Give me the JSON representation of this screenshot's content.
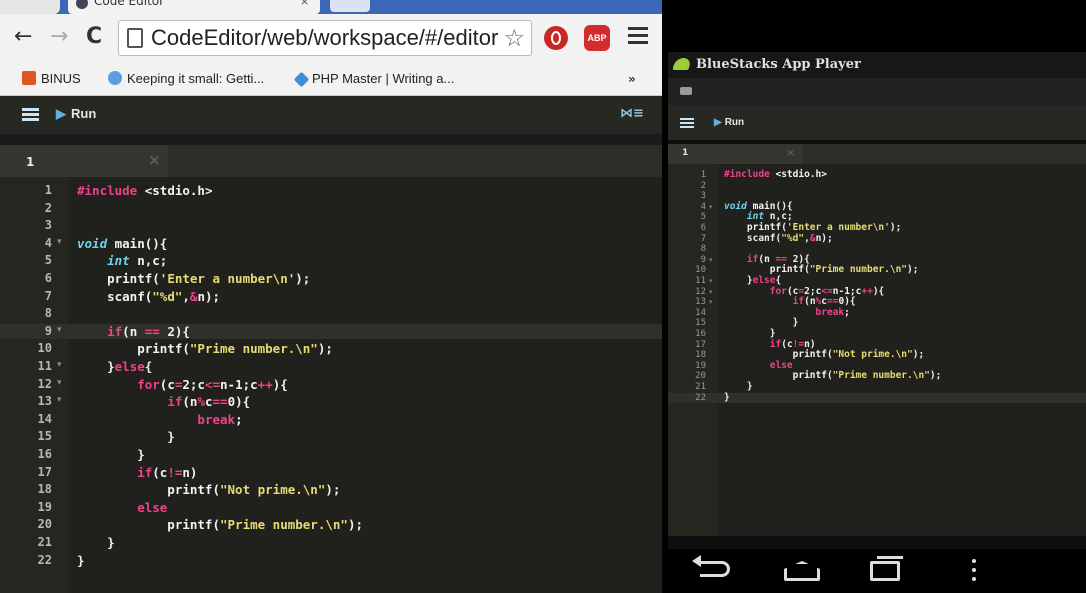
{
  "browser": {
    "tab_title": "Code Editor",
    "tab_close": "×",
    "url": "CodeEditor/web/workspace/#/editor",
    "bookmarks": [
      {
        "label": "BINUS"
      },
      {
        "label": "Keeping it small: Getti..."
      },
      {
        "label": "PHP Master | Writing a..."
      }
    ],
    "bookmarks_more": "»",
    "extensions": {
      "abp_label": "ABP"
    }
  },
  "editor": {
    "run_label": "Run",
    "file_tab": "1",
    "file_tab_close": "×",
    "lines": [
      {
        "n": "1",
        "text": "#include <stdio.h>"
      },
      {
        "n": "2",
        "text": ""
      },
      {
        "n": "3",
        "text": ""
      },
      {
        "n": "4",
        "text": "void main(){"
      },
      {
        "n": "5",
        "text": "    int n,c;"
      },
      {
        "n": "6",
        "text": "    printf('Enter a number\\n');"
      },
      {
        "n": "7",
        "text": "    scanf(\"%d\",&n);"
      },
      {
        "n": "8",
        "text": ""
      },
      {
        "n": "9",
        "text": "    if(n == 2){"
      },
      {
        "n": "10",
        "text": "        printf(\"Prime number.\\n\");"
      },
      {
        "n": "11",
        "text": "    }else{"
      },
      {
        "n": "12",
        "text": "        for(c=2;c<=n-1;c++){"
      },
      {
        "n": "13",
        "text": "            if(n%c==0){"
      },
      {
        "n": "14",
        "text": "                break;"
      },
      {
        "n": "15",
        "text": "            }"
      },
      {
        "n": "16",
        "text": "        }"
      },
      {
        "n": "17",
        "text": "        if(c!=n)"
      },
      {
        "n": "18",
        "text": "            printf(\"Not prime.\\n\");"
      },
      {
        "n": "19",
        "text": "        else"
      },
      {
        "n": "20",
        "text": "            printf(\"Prime number.\\n\");"
      },
      {
        "n": "21",
        "text": "    }"
      },
      {
        "n": "22",
        "text": "}"
      }
    ]
  },
  "bluestacks": {
    "title": "BlueStacks App Player",
    "run_label": "Run",
    "file_tab": "1",
    "file_tab_close": "×",
    "lines": [
      {
        "n": "1",
        "text": "#include <stdio.h>"
      },
      {
        "n": "2",
        "text": ""
      },
      {
        "n": "3",
        "text": ""
      },
      {
        "n": "4",
        "text": "void main(){"
      },
      {
        "n": "5",
        "text": "    int n,c;"
      },
      {
        "n": "6",
        "text": "    printf('Enter a number\\n');"
      },
      {
        "n": "7",
        "text": "    scanf(\"%d\",&n);"
      },
      {
        "n": "8",
        "text": ""
      },
      {
        "n": "9",
        "text": "    if(n == 2){"
      },
      {
        "n": "10",
        "text": "        printf(\"Prime number.\\n\");"
      },
      {
        "n": "11",
        "text": "    }else{"
      },
      {
        "n": "12",
        "text": "        for(c=2;c<=n-1;c++){"
      },
      {
        "n": "13",
        "text": "            if(n%c==0){"
      },
      {
        "n": "14",
        "text": "                break;"
      },
      {
        "n": "15",
        "text": "            }"
      },
      {
        "n": "16",
        "text": "        }"
      },
      {
        "n": "17",
        "text": "        if(c!=n)"
      },
      {
        "n": "18",
        "text": "            printf(\"Not prime.\\n\");"
      },
      {
        "n": "19",
        "text": "        else"
      },
      {
        "n": "20",
        "text": "            printf(\"Prime number.\\n\");"
      },
      {
        "n": "21",
        "text": "    }"
      },
      {
        "n": "22",
        "text": "}"
      }
    ]
  },
  "colors": {
    "keyword": "#f0428a",
    "type": "#6fd3ee",
    "string": "#e6db74",
    "editor_bg": "#20211c"
  }
}
